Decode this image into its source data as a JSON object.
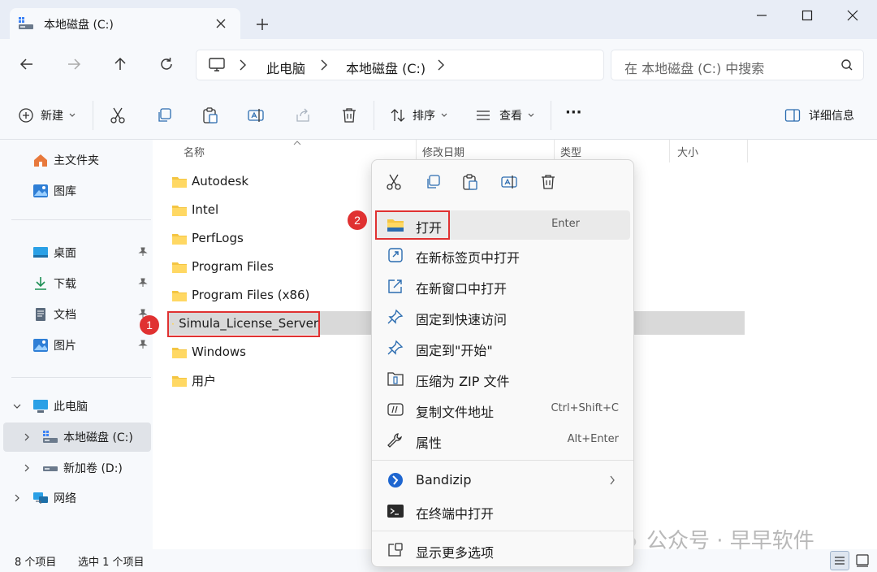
{
  "window": {
    "tab_title": "本地磁盘 (C:)",
    "new_tab_symbol": "+"
  },
  "breadcrumb": [
    "此电脑",
    "本地磁盘 (C:)"
  ],
  "search": {
    "placeholder": "在 本地磁盘 (C:) 中搜索"
  },
  "toolbar": {
    "new_label": "新建",
    "sort_label": "排序",
    "view_label": "查看",
    "more_label": "···",
    "details_label": "详细信息"
  },
  "sidebar": {
    "top": [
      {
        "label": "主文件夹",
        "icon": "home-icon"
      },
      {
        "label": "图库",
        "icon": "gallery-icon"
      }
    ],
    "pinned": [
      {
        "label": "桌面",
        "icon": "desktop-icon"
      },
      {
        "label": "下载",
        "icon": "download-icon"
      },
      {
        "label": "文档",
        "icon": "document-icon"
      },
      {
        "label": "图片",
        "icon": "pictures-icon"
      }
    ],
    "tree": [
      {
        "label": "此电脑",
        "icon": "computer-icon"
      },
      {
        "label": "本地磁盘 (C:)",
        "icon": "drive-icon"
      },
      {
        "label": "新加卷 (D:)",
        "icon": "drive-icon"
      },
      {
        "label": "网络",
        "icon": "network-icon"
      }
    ]
  },
  "columns": [
    "名称",
    "修改日期",
    "类型",
    "大小"
  ],
  "files": [
    "Autodesk",
    "Intel",
    "PerfLogs",
    "Program Files",
    "Program Files (x86)",
    "Simula_License_Server",
    "Windows",
    "用户"
  ],
  "status": {
    "count": "8 个项目",
    "selected": "选中 1 个项目"
  },
  "context_menu": {
    "items": [
      {
        "label": "打开",
        "shortcut": "Enter",
        "icon": "folder-icon"
      },
      {
        "label": "在新标签页中打开",
        "shortcut": "",
        "icon": "open-new-tab-icon"
      },
      {
        "label": "在新窗口中打开",
        "shortcut": "",
        "icon": "open-new-window-icon"
      },
      {
        "label": "固定到快速访问",
        "shortcut": "",
        "icon": "pin-icon"
      },
      {
        "label": "固定到\"开始\"",
        "shortcut": "",
        "icon": "pin-icon"
      },
      {
        "label": "压缩为 ZIP 文件",
        "shortcut": "",
        "icon": "zip-icon"
      },
      {
        "label": "复制文件地址",
        "shortcut": "Ctrl+Shift+C",
        "icon": "copy-path-icon"
      },
      {
        "label": "属性",
        "shortcut": "Alt+Enter",
        "icon": "wrench-icon"
      }
    ],
    "extra": [
      {
        "label": "Bandizip",
        "icon": "bandizip-icon"
      },
      {
        "label": "在终端中打开",
        "icon": "terminal-icon"
      }
    ],
    "more": {
      "label": "显示更多选项",
      "icon": "more-options-icon"
    }
  },
  "annotations": {
    "step1": "1",
    "step2": "2"
  },
  "watermark": "公众号 · 早早软件"
}
